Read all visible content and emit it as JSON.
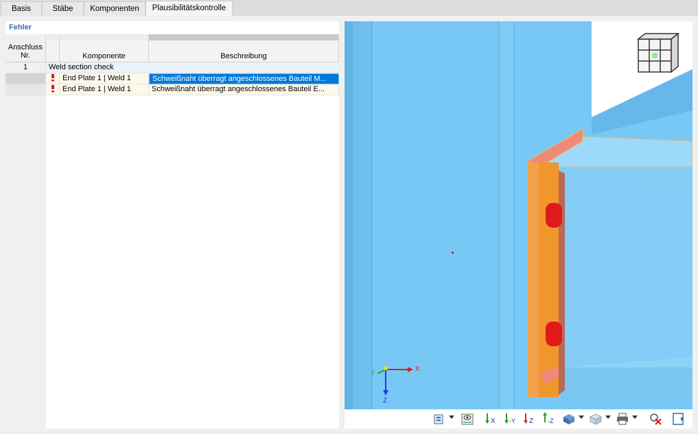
{
  "tabs": [
    {
      "label": "Basis"
    },
    {
      "label": "Stäbe"
    },
    {
      "label": "Komponenten"
    },
    {
      "label": "Plausibilitätskontrolle"
    }
  ],
  "panel": {
    "title": "Fehler",
    "columns": {
      "anschluss_line1": "Anschluss",
      "anschluss_line2": "Nr.",
      "komponente": "Komponente",
      "beschreibung": "Beschreibung"
    },
    "group": {
      "nr": "1",
      "label": "Weld section check"
    },
    "rows": [
      {
        "komponente": "End Plate 1 | Weld 1",
        "beschreibung": "Schweißnaht überragt angeschlossenes Bauteil M...",
        "selected": true
      },
      {
        "komponente": "End Plate 1 | Weld 1",
        "beschreibung": "Schweißnaht überragt angeschlossenes Bauteil E...",
        "selected": false
      }
    ]
  },
  "viewport": {
    "axis_x_label": "X",
    "axis_z_label": "Z",
    "axis_y_label": "Y"
  },
  "toolbar": {
    "icons": [
      "view-settings-icon",
      "visibility-icon",
      "view-x-icon",
      "view-minus-y-icon",
      "view-z-icon",
      "view-minus-z-icon",
      "render-mode-icon",
      "transparency-icon",
      "print-icon",
      "reset-view-icon",
      "exit-view-icon"
    ],
    "axis_labels": {
      "x": "X",
      "minus_y": "-Y",
      "z": "Z",
      "minus_z": "-Z"
    }
  },
  "colors": {
    "steel": "#78c8f5",
    "plate": "#f0962d",
    "selection": "#0078d7",
    "bolt": "#e01a1a"
  }
}
